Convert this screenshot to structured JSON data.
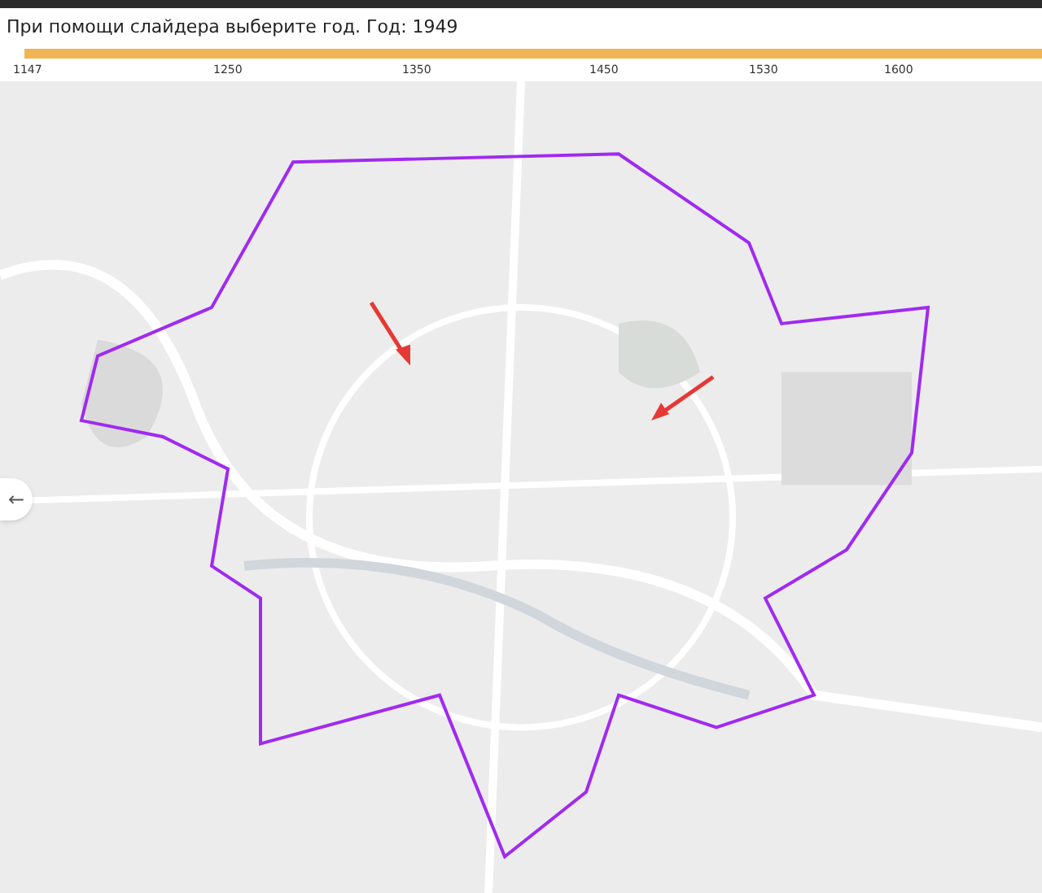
{
  "header": {
    "title": "При помощи слайдера выберите год. Год: 1949"
  },
  "slider": {
    "level": 1,
    "ticks": [
      "1147",
      "1250",
      "1350",
      "1450",
      "1530",
      "1600"
    ]
  },
  "map": {
    "kind": "picture",
    "back_button": "←"
  }
}
